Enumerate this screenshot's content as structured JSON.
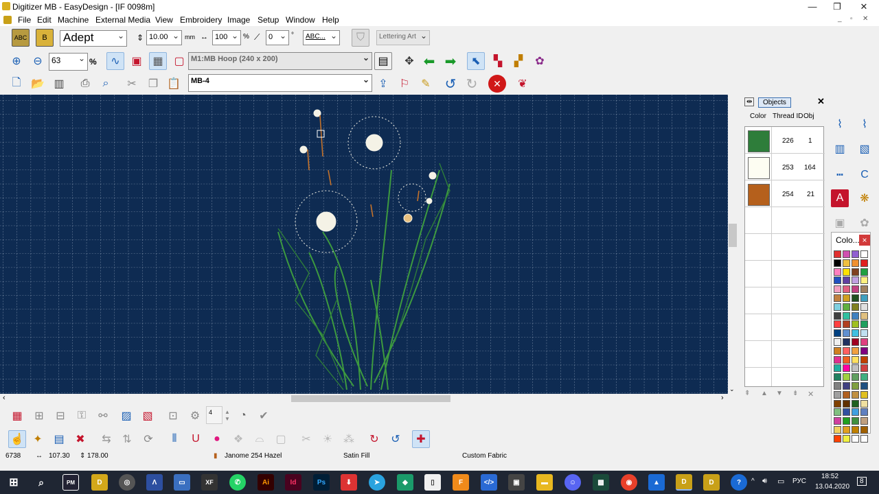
{
  "window": {
    "title": "Digitizer MB - EasyDesign - [IF 0098m]"
  },
  "menu": [
    "File",
    "Edit",
    "Machine",
    "External Media",
    "View",
    "Embroidery",
    "Image",
    "Setup",
    "Window",
    "Help"
  ],
  "toolbar1": {
    "font": "Adept",
    "height": "10.00",
    "height_unit": "mm",
    "width": "100",
    "width_unit": "%",
    "angle": "0",
    "angle_unit": "°",
    "abc": "ABC...",
    "lettering_art": "Lettering Art"
  },
  "toolbar2": {
    "zoom": "63",
    "zoom_unit": "%",
    "hoop": "M1:MB Hoop (240 x 200)"
  },
  "toolbar3": {
    "machine": "MB-4"
  },
  "objects": {
    "tab": "Objects",
    "columns": [
      "Color",
      "Thread ID",
      "Obj"
    ],
    "rows": [
      {
        "color": "#2e7d3a",
        "thread": "226",
        "obj": "1"
      },
      {
        "color": "#fdfdf2",
        "thread": "253",
        "obj": "164"
      },
      {
        "color": "#b5601c",
        "thread": "254",
        "obj": "21"
      }
    ]
  },
  "color_palette": {
    "title": "Colo...",
    "close": "×"
  },
  "bottom": {
    "step": "4"
  },
  "status": {
    "stitches": "6738",
    "width": "107.30",
    "height": "178.00",
    "thread": "Janome 254 Hazel",
    "fill": "Satin Fill",
    "fabric": "Custom Fabric"
  },
  "taskbar": {
    "lang": "РУС",
    "time": "18:52",
    "date": "13.04.2020",
    "notif": "8"
  },
  "icons": {
    "minimize": "minimize-icon",
    "maximize": "maximize-icon",
    "close": "close-icon"
  }
}
